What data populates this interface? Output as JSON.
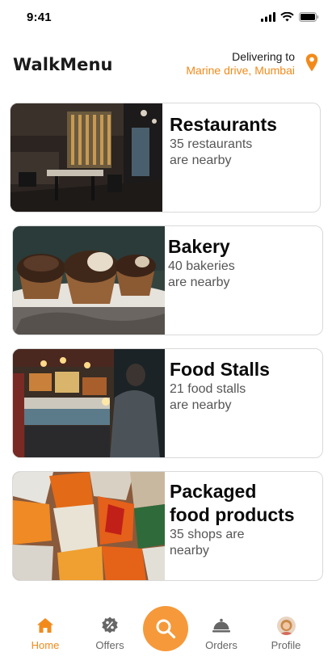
{
  "status_bar": {
    "time": "9:41"
  },
  "header": {
    "brand": "WalkMenu",
    "delivering_label": "Delivering to",
    "location": "Marine drive, Mumbai"
  },
  "categories": [
    {
      "title": "Restaurants",
      "subtitle": "35 restaurants\nare nearby"
    },
    {
      "title": "Bakery",
      "subtitle": "40 bakeries\nare nearby"
    },
    {
      "title": "Food Stalls",
      "subtitle": "21 food stalls\nare nearby"
    },
    {
      "title": "Packaged\nfood products",
      "subtitle": "35 shops are\nnearby"
    }
  ],
  "bottom_nav": {
    "home": "Home",
    "offers": "Offers",
    "orders": "Orders",
    "profile": "Profile"
  },
  "colors": {
    "accent": "#f28a1b",
    "fab": "#f6993a"
  },
  "icons": {
    "pin": "location-pin-icon",
    "home": "home-icon",
    "offers": "discount-badge-icon",
    "search": "search-icon",
    "orders": "cloche-icon"
  }
}
